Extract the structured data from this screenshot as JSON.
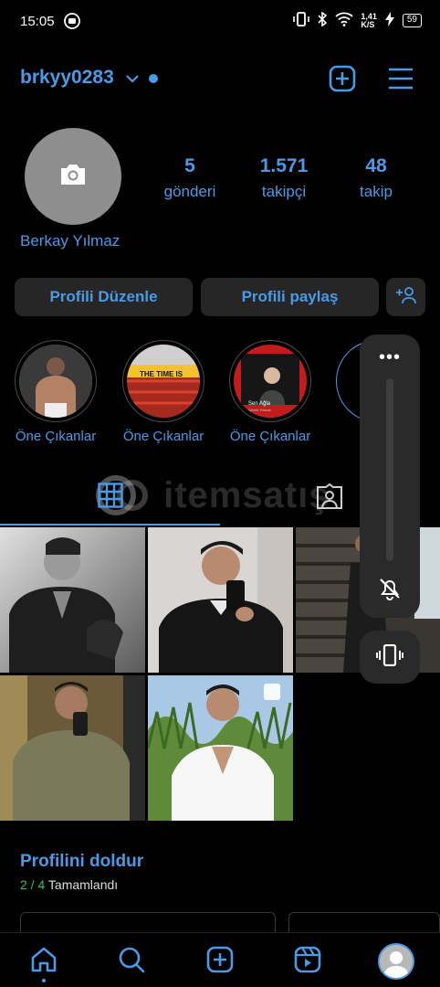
{
  "status_bar": {
    "time": "15:05",
    "net_speed_value": "1,41",
    "net_speed_unit": "K/S",
    "battery": "59"
  },
  "header": {
    "username": "brkyy0283",
    "icons": [
      "chevron-down-icon",
      "new-post-icon",
      "menu-icon"
    ]
  },
  "profile": {
    "full_name": "Berkay Yılmaz",
    "stats": [
      {
        "value": "5",
        "label": "gönderi"
      },
      {
        "value": "1.571",
        "label": "takipçi"
      },
      {
        "value": "48",
        "label": "takip"
      }
    ]
  },
  "actions": {
    "edit_label": "Profili Düzenle",
    "share_label": "Profili paylaş"
  },
  "highlights": [
    {
      "label": "Öne Çıkanlar"
    },
    {
      "label": "Öne Çıkanlar",
      "overlay_text": "THE TIME IS"
    },
    {
      "label": "Öne Çıkanlar",
      "overlay_text": "Sen Ağla",
      "overlay_sub": "Semih Yılmaz"
    }
  ],
  "watermark": {
    "text": "itemsatış"
  },
  "volume_overlay": {
    "more_label": "•••"
  },
  "complete_profile": {
    "title": "Profilini doldur",
    "progress_done": "2",
    "progress_sep": " / ",
    "progress_total": "4",
    "progress_label": " Tamamlandı"
  },
  "nav": {
    "items": [
      "home-icon",
      "search-icon",
      "create-icon",
      "reels-icon",
      "profile-avatar"
    ]
  },
  "colors": {
    "accent": "#4a9ae6",
    "background": "#000000",
    "button_bg": "#262626",
    "success": "#2ec15e"
  }
}
